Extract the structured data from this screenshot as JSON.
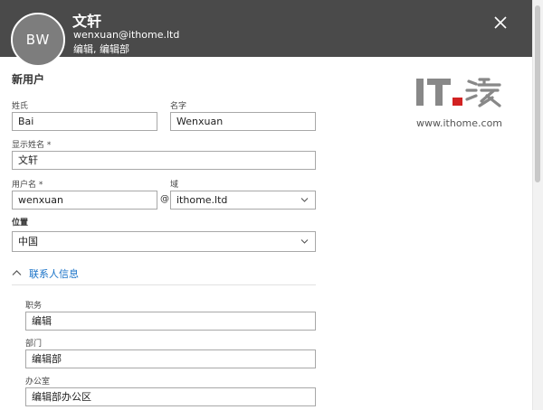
{
  "header": {
    "avatar_initials": "BW",
    "display_name": "文轩",
    "email": "wenxuan@ithome.ltd",
    "department_line": "编辑, 编辑部"
  },
  "form": {
    "section_title": "新用户",
    "last_name": {
      "label": "姓氏",
      "value": "Bai"
    },
    "first_name": {
      "label": "名字",
      "value": "Wenxuan"
    },
    "display_name": {
      "label": "显示姓名 *",
      "value": "文轩"
    },
    "username": {
      "label": "用户名 *",
      "value": "wenxuan"
    },
    "at_sign": "@",
    "domain": {
      "label": "域",
      "value": "ithome.ltd"
    },
    "location": {
      "label": "位置",
      "value": "中国"
    }
  },
  "contact_info": {
    "label": "联系人信息",
    "job_title": {
      "label": "职务",
      "value": "编辑"
    },
    "department": {
      "label": "部门",
      "value": "编辑部"
    },
    "office": {
      "label": "办公室",
      "value": "编辑部办公区"
    }
  },
  "watermark": {
    "url": "www.ithome.com"
  },
  "colors": {
    "header_bg": "#4a4a4a",
    "link_blue": "#1a73c8",
    "logo_red": "#d22222",
    "logo_gray": "#888888"
  }
}
